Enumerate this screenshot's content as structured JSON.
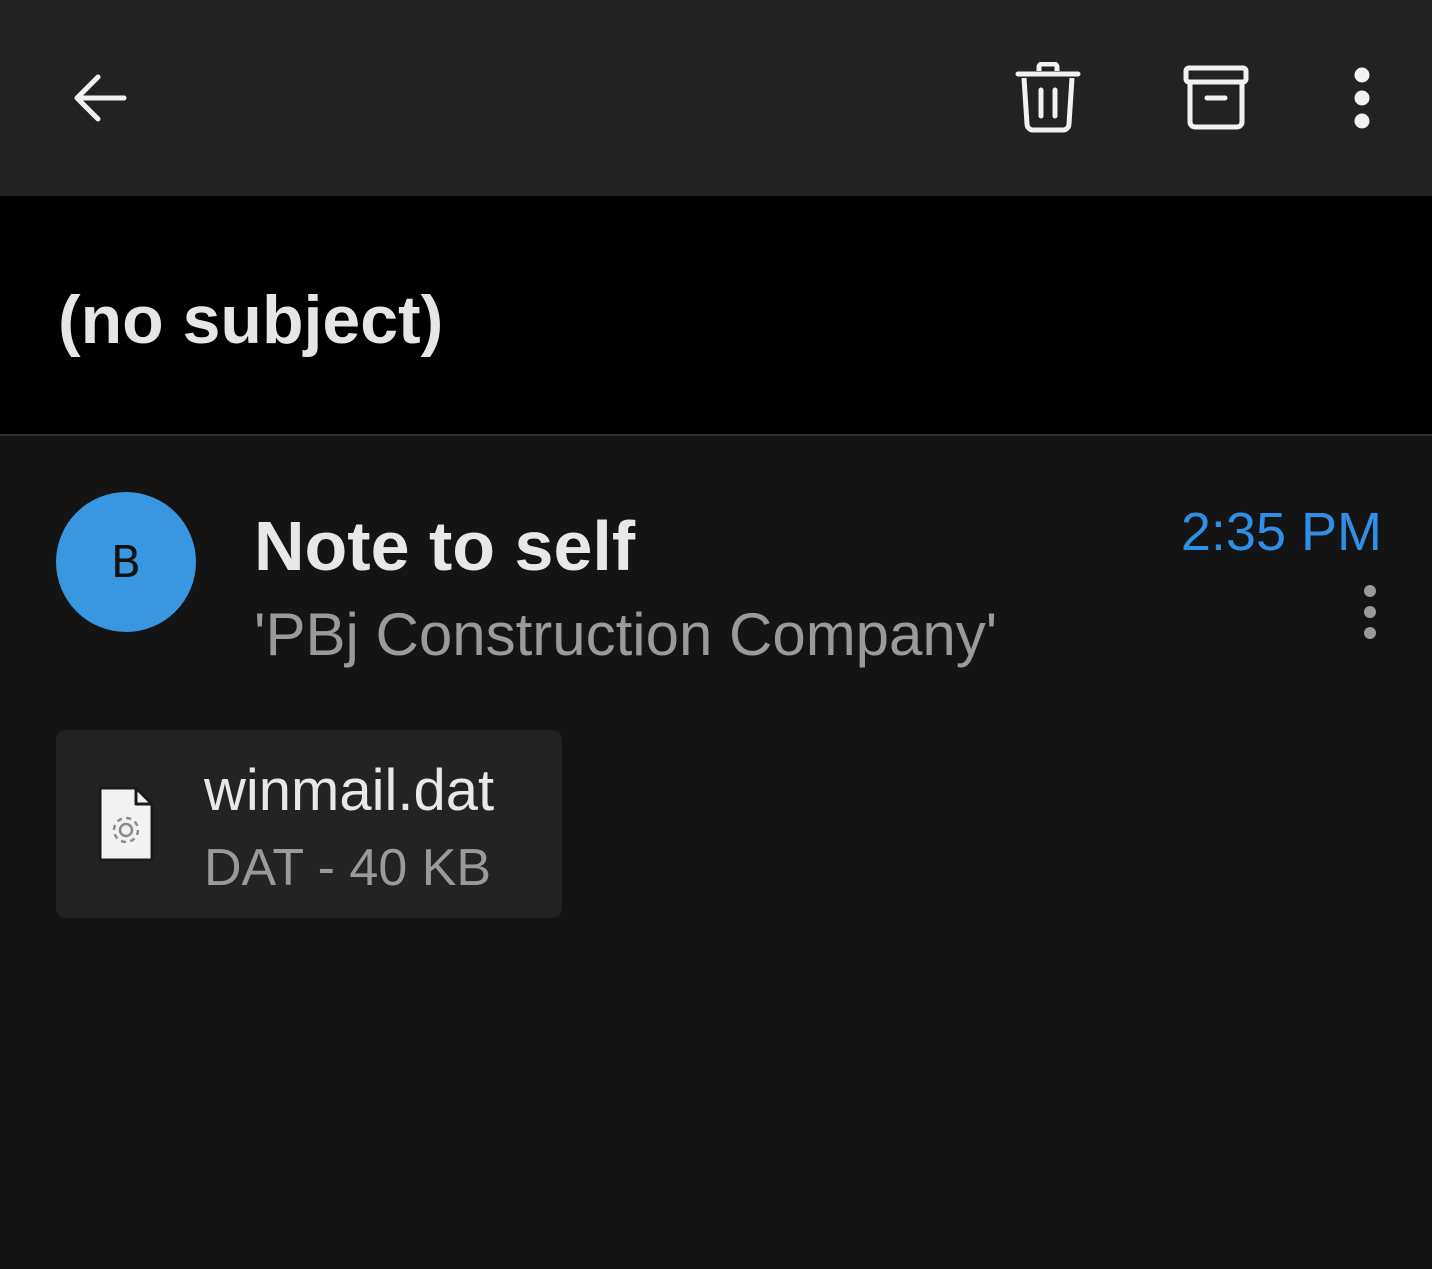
{
  "toolbar": {
    "back_icon": "arrow-left-icon",
    "delete_icon": "trash-icon",
    "archive_icon": "archive-box-icon",
    "more_icon": "more-vertical-icon"
  },
  "email": {
    "subject": "(no subject)",
    "sender": {
      "avatar_initial": "B",
      "avatar_color": "#3897e0",
      "name": "Note to self",
      "company": "'PBj Construction Company'"
    },
    "time": "2:35 PM",
    "time_color": "#2f8fe6",
    "message_more_icon": "more-vertical-icon",
    "attachments": [
      {
        "name": "winmail.dat",
        "meta": "DAT - 40 KB",
        "icon": "file-settings-icon"
      }
    ]
  }
}
